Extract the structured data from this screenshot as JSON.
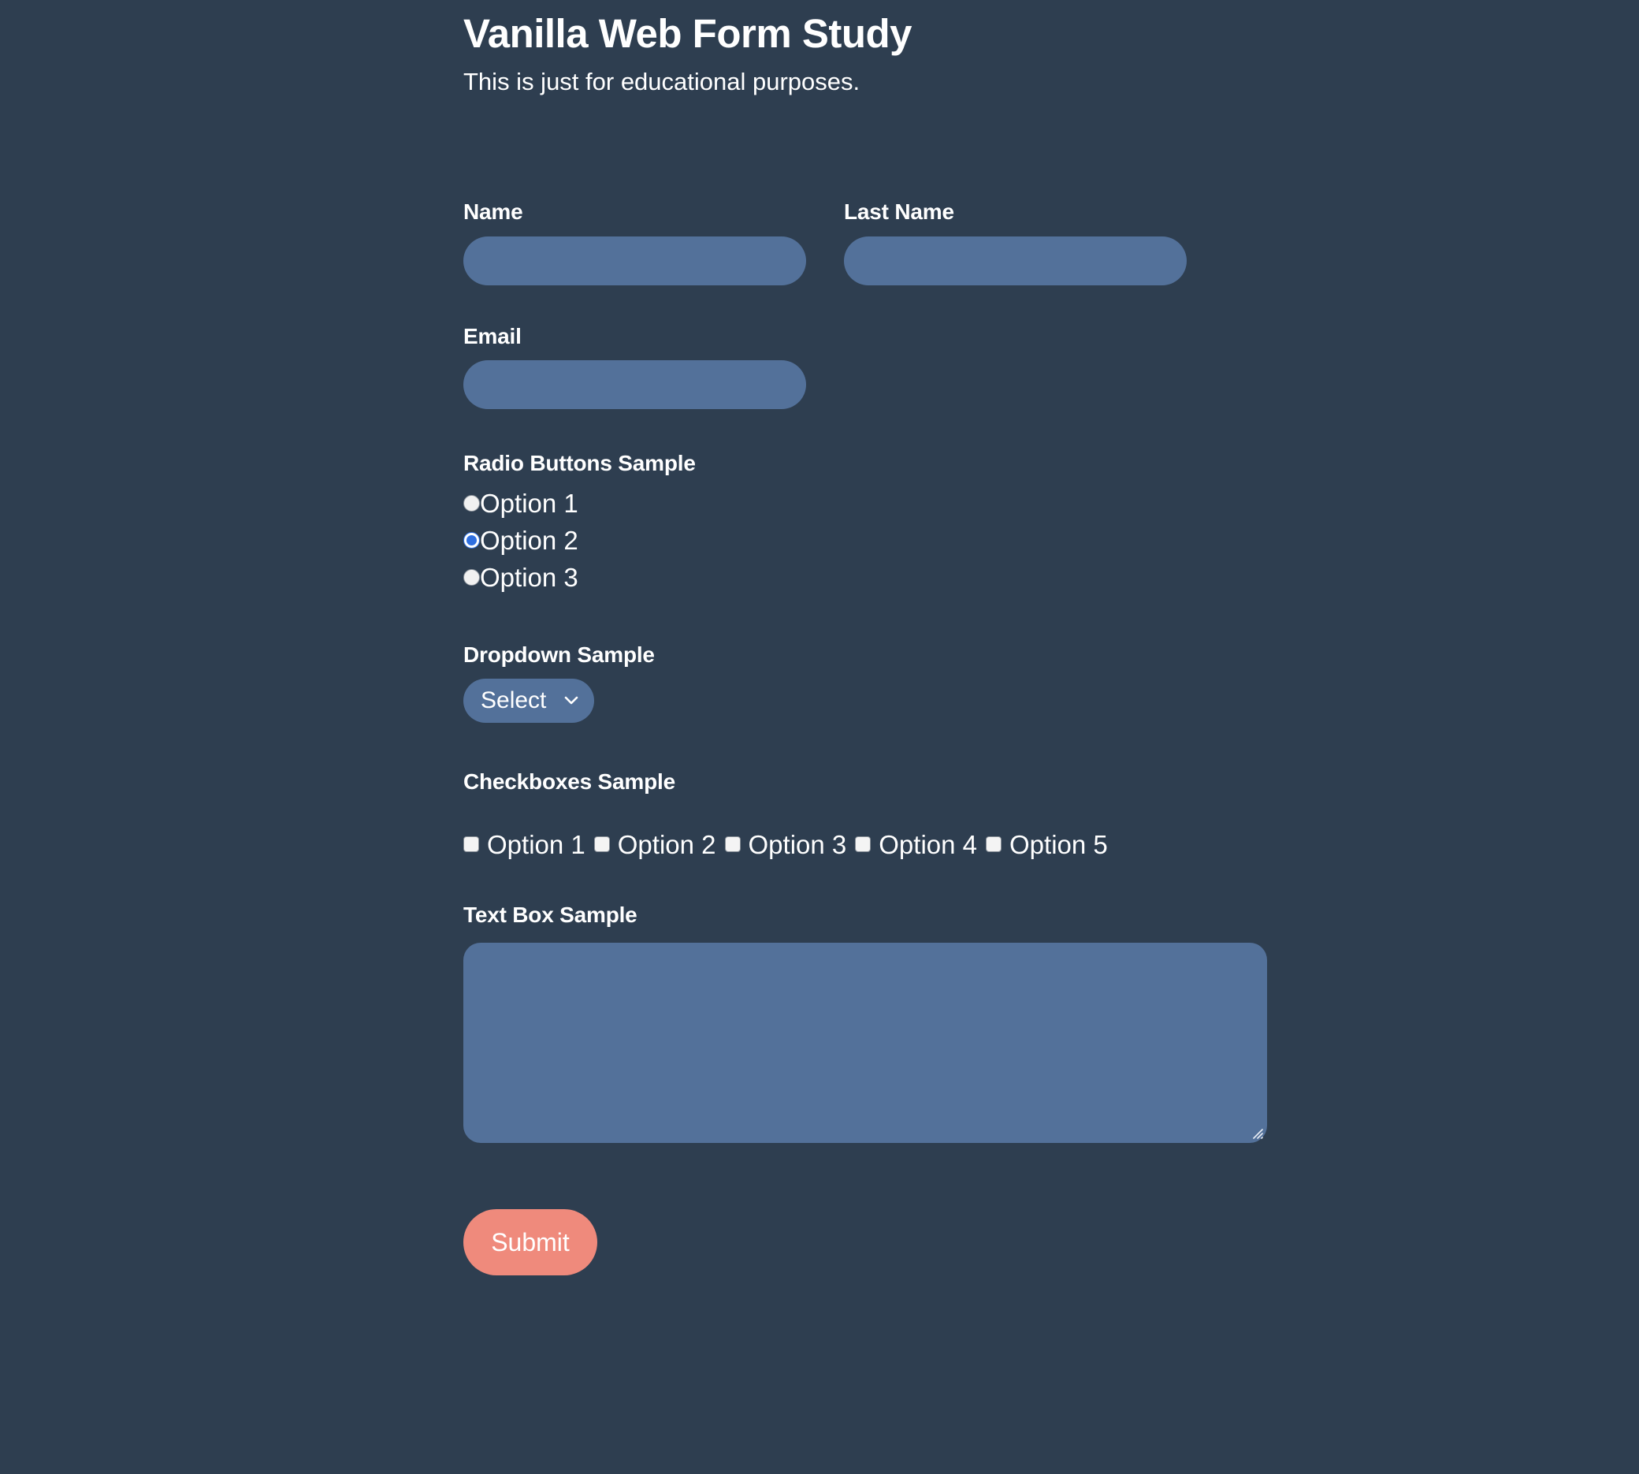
{
  "header": {
    "title": "Vanilla Web Form Study",
    "subtitle": "This is just for educational purposes."
  },
  "theme": {
    "background": "#2e3e50",
    "field_fill": "#53719a",
    "accent_submit": "#ef8a7c",
    "radio_selected": "#2f6fe0",
    "text": "#ffffff"
  },
  "form": {
    "name": {
      "label": "Name",
      "value": "",
      "placeholder": ""
    },
    "last_name": {
      "label": "Last Name",
      "value": "",
      "placeholder": ""
    },
    "email": {
      "label": "Email",
      "value": "",
      "placeholder": ""
    },
    "radios": {
      "heading": "Radio Buttons Sample",
      "selected_index": 1,
      "options": [
        {
          "label": "Option 1",
          "checked": false
        },
        {
          "label": "Option 2",
          "checked": true
        },
        {
          "label": "Option 3",
          "checked": false
        }
      ]
    },
    "dropdown": {
      "heading": "Dropdown Sample",
      "selected": "Select",
      "options": [
        "Select"
      ],
      "chevron_icon": "chevron-down-icon"
    },
    "checkboxes": {
      "heading": "Checkboxes Sample",
      "options": [
        {
          "label": "Option 1",
          "checked": false
        },
        {
          "label": "Option 2",
          "checked": false
        },
        {
          "label": "Option 3",
          "checked": false
        },
        {
          "label": "Option 4",
          "checked": false
        },
        {
          "label": "Option 5",
          "checked": false
        }
      ]
    },
    "textarea": {
      "heading": "Text Box Sample",
      "value": "",
      "placeholder": ""
    },
    "submit": {
      "label": "Submit"
    }
  }
}
